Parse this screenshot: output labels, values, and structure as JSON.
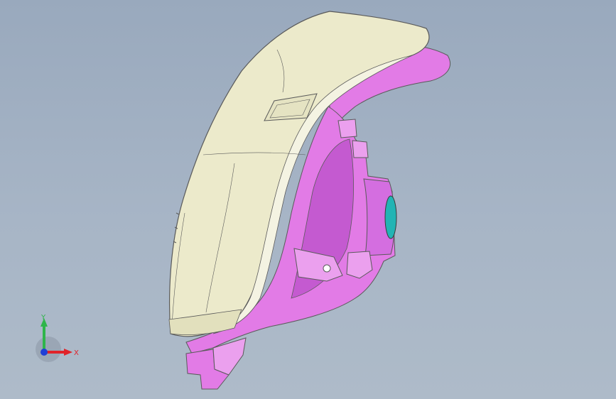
{
  "viewport": {
    "background_top": "#99a9bd",
    "background_bottom": "#aebbc9"
  },
  "model": {
    "lens_color": "#eceacb",
    "housing_color": "#e27be6",
    "housing_shadow": "#c45ad0",
    "bulb_color": "#22b4b4",
    "edge_color": "#5a5a5a"
  },
  "triad": {
    "x_label": "X",
    "y_label": "Y",
    "x_color": "#e0242a",
    "y_color": "#2fb54a",
    "z_color": "#1f3fd6"
  }
}
